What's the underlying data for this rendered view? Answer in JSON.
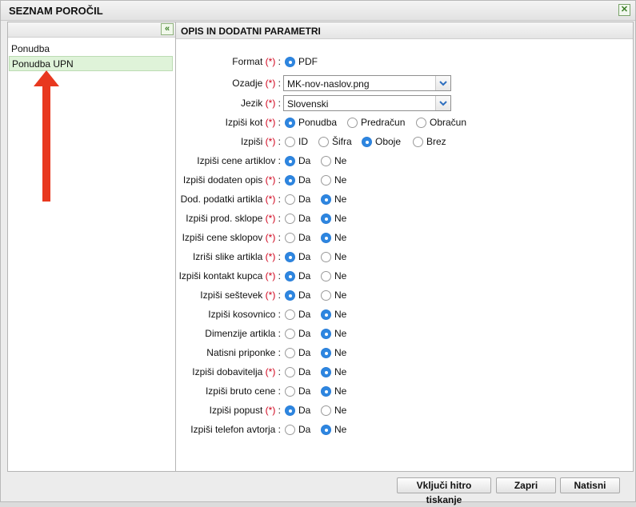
{
  "dialog": {
    "title": "SEZNAM POROČIL"
  },
  "left": {
    "items": [
      {
        "label": "Ponudba",
        "selected": false
      },
      {
        "label": "Ponudba UPN",
        "selected": true
      }
    ]
  },
  "right": {
    "header": "OPIS IN DODATNI PARAMETRI",
    "required_mark": "(*)",
    "format": {
      "label": "Format",
      "required": true,
      "options": [
        "PDF"
      ],
      "selected": 0
    },
    "ozadje": {
      "label": "Ozadje",
      "required": true,
      "value": "MK-nov-naslov.png"
    },
    "jezik": {
      "label": "Jezik",
      "required": true,
      "value": "Slovenski"
    },
    "izpisi_kot": {
      "label": "Izpiši kot",
      "required": true,
      "options": [
        "Ponudba",
        "Predračun",
        "Obračun"
      ],
      "selected": 0
    },
    "izpisi": {
      "label": "Izpiši",
      "required": true,
      "options": [
        "ID",
        "Šifra",
        "Oboje",
        "Brez"
      ],
      "selected": 2
    },
    "yesno_options": [
      "Da",
      "Ne"
    ],
    "yesno": [
      {
        "label": "Izpiši cene artiklov",
        "required": false,
        "value": "Da"
      },
      {
        "label": "Izpiši dodaten opis",
        "required": true,
        "value": "Da"
      },
      {
        "label": "Dod. podatki artikla",
        "required": true,
        "value": "Ne"
      },
      {
        "label": "Izpiši prod. sklope",
        "required": true,
        "value": "Ne"
      },
      {
        "label": "Izpiši cene sklopov",
        "required": true,
        "value": "Ne"
      },
      {
        "label": "Izriši slike artikla",
        "required": true,
        "value": "Da"
      },
      {
        "label": "Izpiši kontakt kupca",
        "required": true,
        "value": "Da"
      },
      {
        "label": "Izpiši seštevek",
        "required": true,
        "value": "Da"
      },
      {
        "label": "Izpiši kosovnico",
        "required": false,
        "value": "Ne"
      },
      {
        "label": "Dimenzije artikla",
        "required": false,
        "value": "Ne"
      },
      {
        "label": "Natisni priponke",
        "required": false,
        "value": "Ne"
      },
      {
        "label": "Izpiši dobavitelja",
        "required": true,
        "value": "Ne"
      },
      {
        "label": "Izpiši bruto cene",
        "required": false,
        "value": "Ne"
      },
      {
        "label": "Izpiši popust",
        "required": true,
        "value": "Da"
      },
      {
        "label": "Izpiši telefon avtorja",
        "required": false,
        "value": "Ne"
      }
    ]
  },
  "buttons": {
    "quick_print": "Vključi hitro tiskanje",
    "close": "Zapri",
    "print": "Natisni"
  },
  "colors": {
    "accent": "#2e86e0",
    "required": "#d0021b",
    "annotation_arrow": "#e8381f",
    "selected_row": "#dff3d9"
  }
}
